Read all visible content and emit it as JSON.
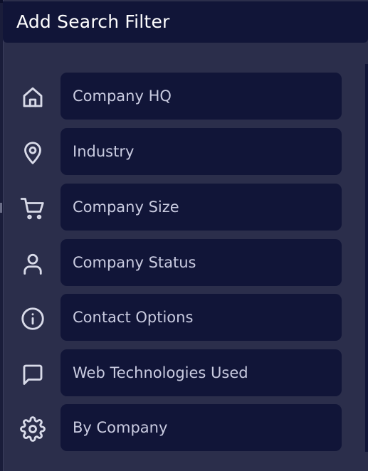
{
  "dialog": {
    "title": "Add Search Filter"
  },
  "filters": [
    {
      "label": "Company HQ",
      "icon": "home-icon"
    },
    {
      "label": "Industry",
      "icon": "map-pin-icon"
    },
    {
      "label": "Company Size",
      "icon": "shopping-cart-icon"
    },
    {
      "label": "Company Status",
      "icon": "user-icon"
    },
    {
      "label": "Contact Options",
      "icon": "info-icon"
    },
    {
      "label": "Web Technologies Used",
      "icon": "message-square-icon"
    },
    {
      "label": "By Company",
      "icon": "settings-gear-icon"
    }
  ],
  "colors": {
    "panel_background": "#2b2e4b",
    "item_background": "#111538",
    "header_background": "#111538",
    "title_text": "#ffffff",
    "item_text": "#c9cbe0",
    "icon_stroke": "#d9dbe9"
  }
}
